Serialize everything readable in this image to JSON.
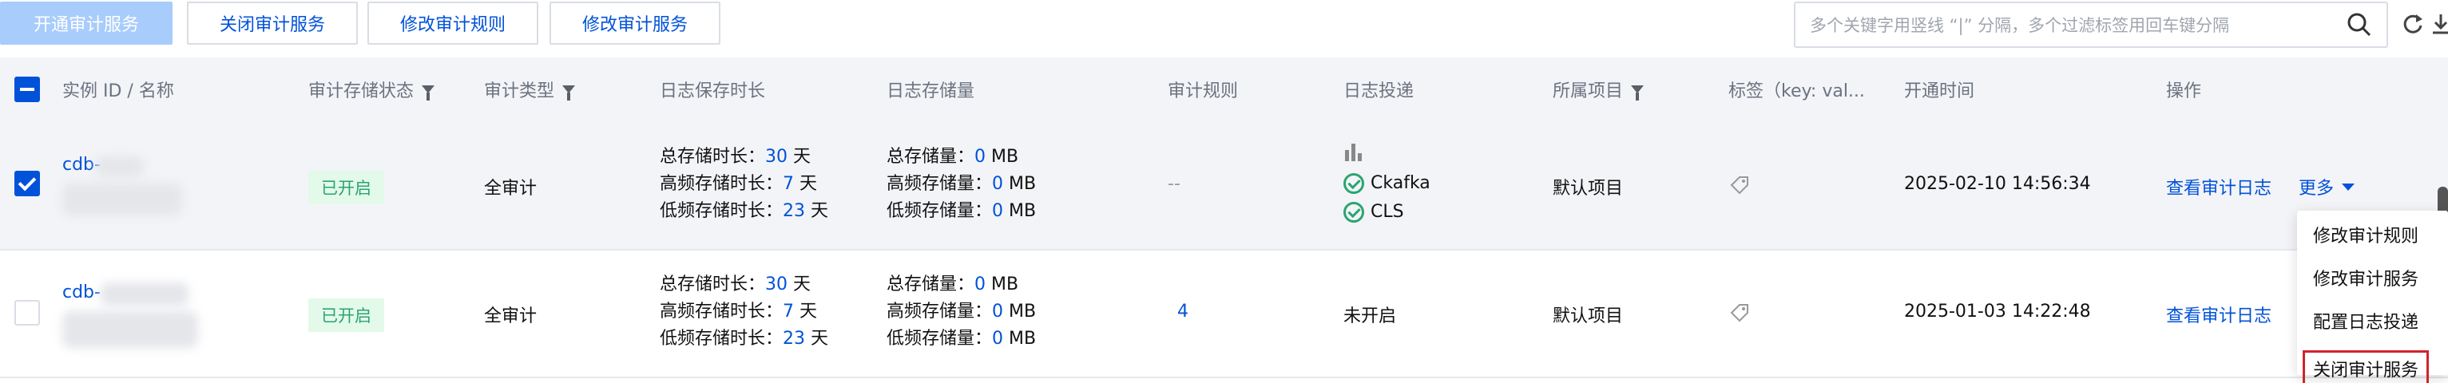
{
  "toolbar": {
    "open_audit": "开通审计服务",
    "close_audit": "关闭审计服务",
    "modify_rules": "修改审计规则",
    "modify_service": "修改审计服务",
    "search_placeholder": "多个关键字用竖线 “|” 分隔，多个过滤标签用回车键分隔",
    "search_icon": "search-icon",
    "refresh_icon": "refresh-icon",
    "download_icon": "download-icon"
  },
  "table": {
    "headers": {
      "instance": "实例 ID / 名称",
      "storage_status": "审计存储状态",
      "audit_type": "审计类型",
      "log_retention": "日志保存时长",
      "log_storage": "日志存储量",
      "audit_rules": "审计规则",
      "log_delivery": "日志投递",
      "project": "所属项目",
      "tags": "标签（key: val...",
      "open_time": "开通时间",
      "actions": "操作"
    },
    "rows": [
      {
        "instance_id": "cdb-",
        "status": "已开启",
        "audit_type": "全审计",
        "retention": {
          "total_label": "总存储时长：",
          "total_value": "30",
          "total_unit": " 天",
          "high_label": "高频存储时长：",
          "high_value": "7",
          "high_unit": " 天",
          "low_label": "低频存储时长：",
          "low_value": "23",
          "low_unit": " 天"
        },
        "storage": {
          "total_label": "总存储量：",
          "total_value": "0",
          "total_unit": " MB",
          "high_label": "高频存储量：",
          "high_value": "0",
          "high_unit": " MB",
          "low_label": "低频存储量：",
          "low_value": "0",
          "low_unit": " MB"
        },
        "rules": "--",
        "delivery": [
          "Ckafka",
          "CLS"
        ],
        "project": "默认项目",
        "open_time": "2025-02-10 14:56:34",
        "action_view": "查看审计日志",
        "action_more": "更多"
      },
      {
        "instance_id": "cdb-",
        "status": "已开启",
        "audit_type": "全审计",
        "retention": {
          "total_label": "总存储时长：",
          "total_value": "30",
          "total_unit": " 天",
          "high_label": "高频存储时长：",
          "high_value": "7",
          "high_unit": " 天",
          "low_label": "低频存储时长：",
          "low_value": "23",
          "low_unit": " 天"
        },
        "storage": {
          "total_label": "总存储量：",
          "total_value": "0",
          "total_unit": " MB",
          "high_label": "高频存储量：",
          "high_value": "0",
          "high_unit": " MB",
          "low_label": "低频存储量：",
          "low_value": "0",
          "low_unit": " MB"
        },
        "rules": "4",
        "delivery_text": "未开启",
        "project": "默认项目",
        "open_time": "2025-01-03 14:22:48",
        "action_view": "查看审计日志"
      }
    ]
  },
  "menu": {
    "items": [
      "修改审计规则",
      "修改审计服务",
      "配置日志投递",
      "关闭审计服务"
    ]
  },
  "colors": {
    "primary": "#0052d9",
    "success": "#2ba471",
    "highlight_border": "#d1232a"
  }
}
